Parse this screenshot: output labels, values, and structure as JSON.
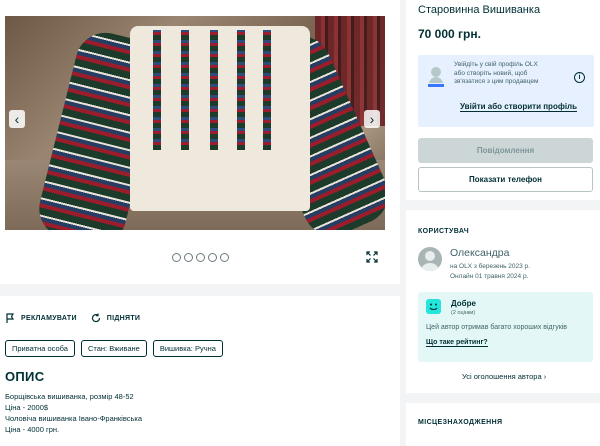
{
  "gallery": {
    "dots_count": 5,
    "prev_arrow": "‹",
    "next_arrow": "›"
  },
  "actions": {
    "promote": "РЕКЛАМУВАТИ",
    "raise": "ПІДНЯТИ"
  },
  "chips": [
    "Приватна особа",
    "Стан: Вживане",
    "Вишивка: Ручна"
  ],
  "description": {
    "heading": "ОПИС",
    "lines": [
      "Борщівська вишиванка, розмір 48-52",
      "Ціна - 2000$",
      "Чоловіча вишиванка Івано-Франківська",
      "Ціна - 4000 грн."
    ]
  },
  "ad": {
    "title": "Старовинна Вишиванка",
    "price": "70 000 грн."
  },
  "login_box": {
    "line1": "Увійдіть у свій профіль OLX",
    "line2": "або створіть новий, щоб",
    "line3": "зв'язатися з цим продавцем",
    "info": "i",
    "link": "Увійти або створити профіль"
  },
  "buttons": {
    "message": "Повідомлення",
    "phone": "Показати телефон"
  },
  "user": {
    "header": "КОРИСТУВАЧ",
    "name": "Олександра",
    "since": "на OLX з березень 2023 р.",
    "online": "Онлайн 01 травня 2024 р.",
    "rating_title": "Добре",
    "rating_count": "(2 оцінки)",
    "rating_text": "Цей автор отримав багато хороших відгуків",
    "rating_link": "Що таке рейтинг?",
    "all_ads": "Усі оголошення автора ›"
  },
  "location": {
    "header": "МІСЦЕЗНАХОДЖЕННЯ"
  },
  "colors": {
    "text": "#002f34",
    "background": "#f2f4f5",
    "login_box_bg": "#e7f0ff",
    "rating_bg": "#e3f8f6",
    "rating_icon": "#23e5db",
    "disabled_button": "#ccd6d7"
  }
}
